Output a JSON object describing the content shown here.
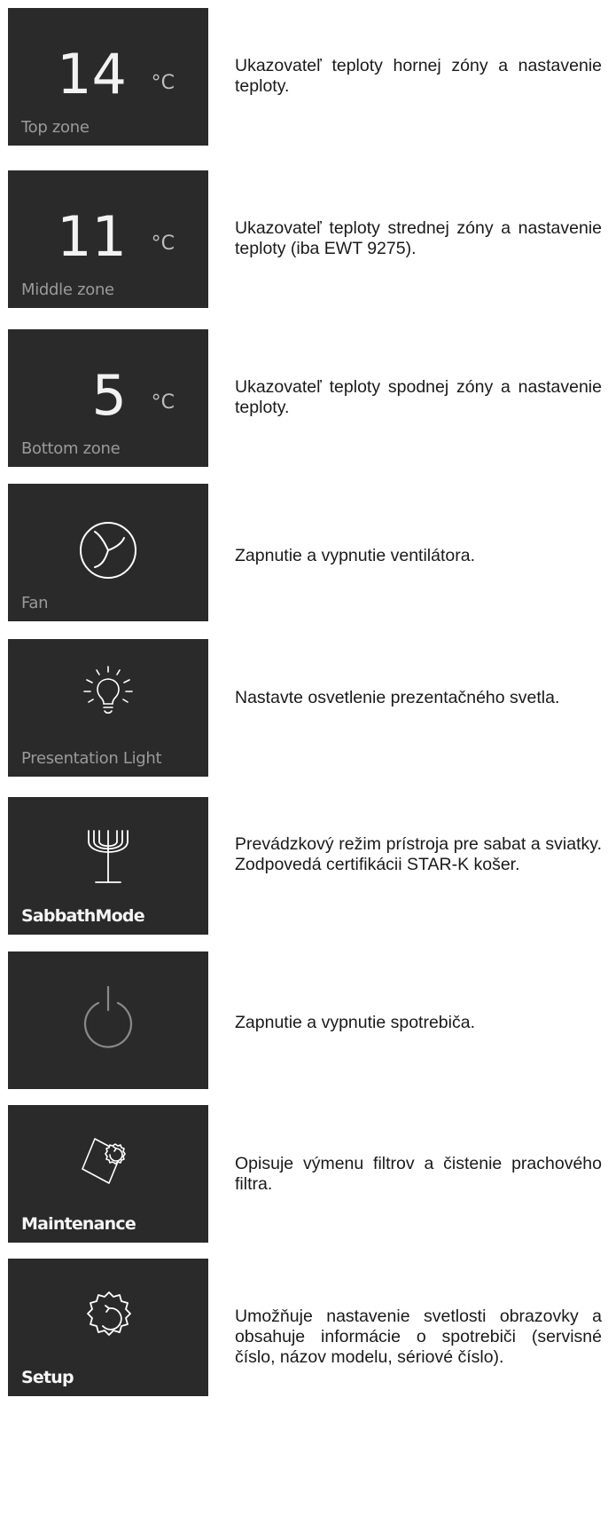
{
  "rows": [
    {
      "label": "Top zone",
      "value": "14",
      "unit": "°C",
      "description": "Ukazovateľ teploty hornej zóny a nastavenie teploty."
    },
    {
      "label": "Middle zone",
      "value": "11",
      "unit": "°C",
      "description": "Ukazovateľ teploty strednej zóny a nastavenie teploty (iba EWT 9275)."
    },
    {
      "label": "Bottom zone",
      "value": "5",
      "unit": "°C",
      "description": "Ukazovateľ teploty spodnej zóny a nastavenie teploty."
    },
    {
      "label": "Fan",
      "icon": "fan-icon",
      "description": "Zapnutie a vypnutie ventilátora."
    },
    {
      "label": "Presentation Light",
      "icon": "light-bulb-icon",
      "description": "Nastavte osvetlenie prezentačného svetla."
    },
    {
      "label": "SabbathMode",
      "icon": "menorah-icon",
      "description": "Prevádzkový režim prístroja pre sabat a sviatky. Zodpovedá certifikácii STAR-K košer."
    },
    {
      "label": "",
      "icon": "power-icon",
      "description": "Zapnutie a vypnutie spotrebiča."
    },
    {
      "label": "Maintenance",
      "icon": "maintenance-icon",
      "description": "Opisuje výmenu filtrov a čistenie prachového filtra."
    },
    {
      "label": "Setup",
      "icon": "settings-gear-icon",
      "description": "Umožňuje nastavenie svetlosti obrazovky a obsahuje informácie o spotrebiči (servisné číslo, názov modelu, sériové číslo)."
    }
  ]
}
